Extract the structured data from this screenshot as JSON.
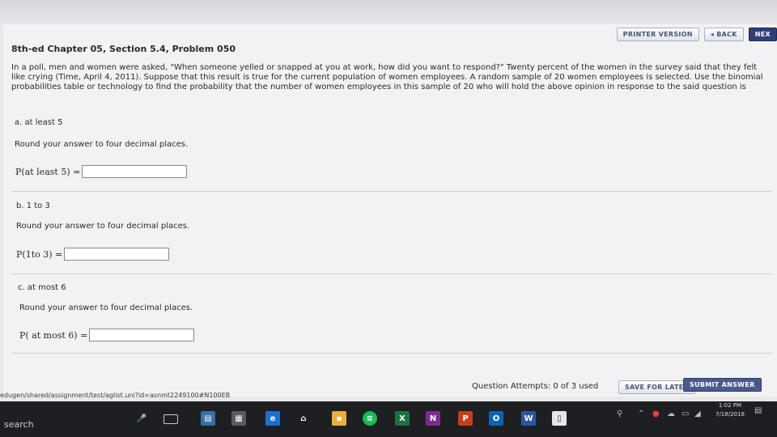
{
  "toolbar": {
    "printer_version": "PRINTER VERSION",
    "back": "◂ BACK",
    "next": "NEX"
  },
  "problem": {
    "title": "8th-ed Chapter 05, Section 5.4, Problem 050",
    "question": "In a poll, men and women were asked, \"When someone yelled or snapped at you at work, how did you want to respond?\" Twenty percent of the women in the survey said that they felt like crying (Time, April 4, 2011). Suppose that this result is true for the current population of women employees. A random sample of 20 women employees is selected. Use the binomial probabilities table or technology to find the probability that the number of women employees in this sample of 20 who will hold the above opinion in response to the said question is"
  },
  "parts": [
    {
      "label": "a. at least 5",
      "instruction": "Round your answer to four decimal places.",
      "prob_label": "P(at least 5) =",
      "value": ""
    },
    {
      "label": "b. 1 to 3",
      "instruction": "Round your answer to four decimal places.",
      "prob_label": "P(1to 3) =",
      "value": ""
    },
    {
      "label": "c. at most 6",
      "instruction": "Round your answer to four decimal places.",
      "prob_label": "P( at most 6) =",
      "value": ""
    }
  ],
  "footer": {
    "url": "edugen/shared/assignment/test/aglist.uni?id=asnmt2249100#N100EB",
    "attempts": "Question Attempts: 0 of 3 used",
    "save_later": "SAVE FOR LATER",
    "submit": "SUBMIT ANSWER"
  },
  "taskbar": {
    "search": "search",
    "time": "1:02 PM",
    "date": "7/18/2018"
  }
}
